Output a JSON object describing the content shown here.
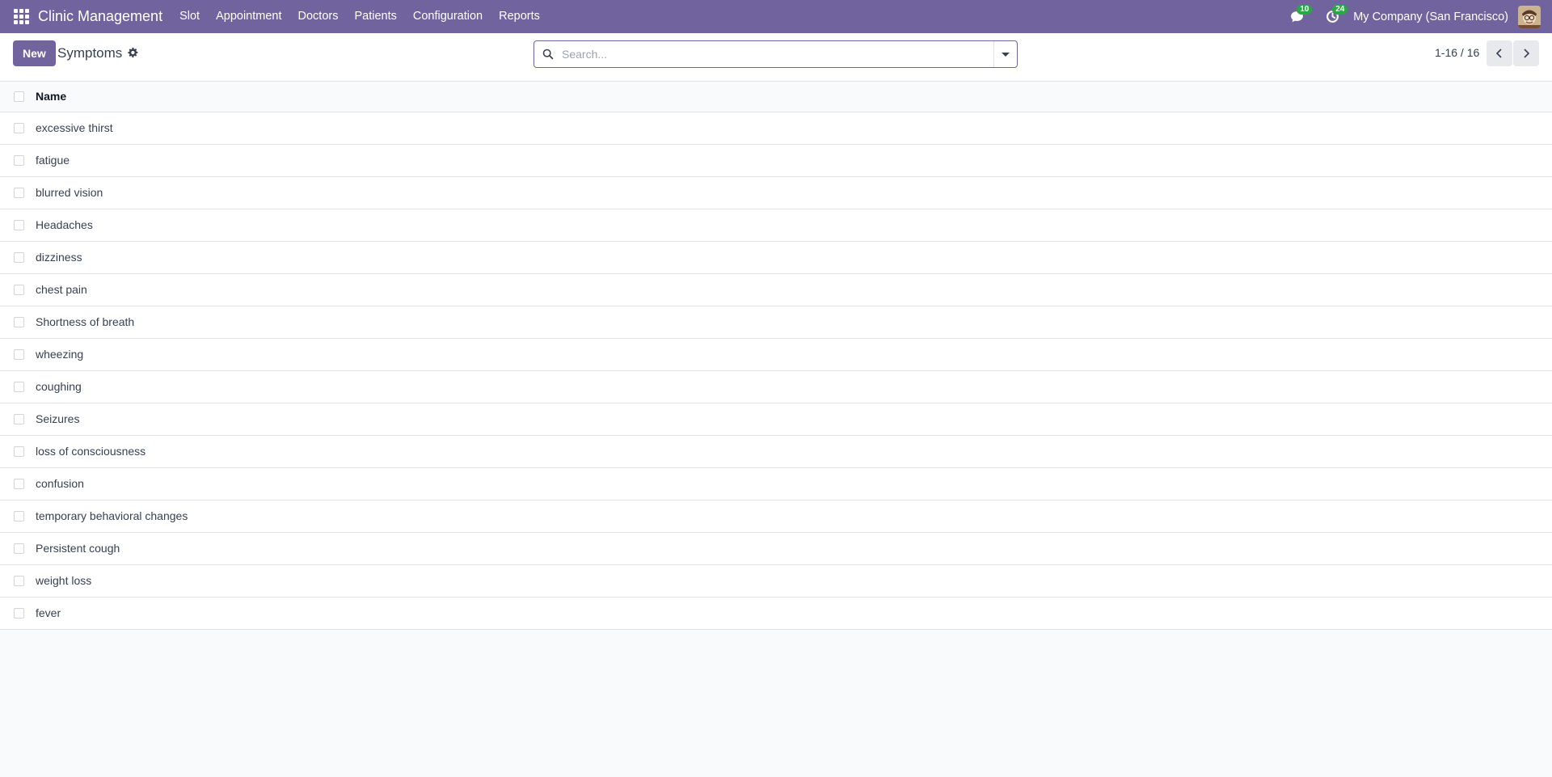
{
  "navbar": {
    "brand": "Clinic Management",
    "menu": [
      "Slot",
      "Appointment",
      "Doctors",
      "Patients",
      "Configuration",
      "Reports"
    ],
    "messages_badge": "10",
    "activities_badge": "24",
    "company": "My Company (San Francisco)"
  },
  "control": {
    "new_label": "New",
    "breadcrumb": "Symptoms",
    "search_placeholder": "Search...",
    "pager": "1-16 / 16"
  },
  "list": {
    "header": "Name",
    "rows": [
      "excessive thirst",
      "fatigue",
      "blurred vision",
      "Headaches",
      "dizziness",
      "chest pain",
      "Shortness of breath",
      "wheezing",
      "coughing",
      "Seizures",
      "loss of consciousness",
      "confusion",
      "temporary behavioral changes",
      "Persistent cough",
      "weight loss",
      "fever"
    ]
  },
  "colors": {
    "brand": "#71639e",
    "badge": "#28a745"
  },
  "icons": [
    "apps-grid-icon",
    "chat-icon",
    "activity-clock-icon",
    "gear-icon",
    "search-icon",
    "caret-down-icon",
    "chevron-left-icon",
    "chevron-right-icon"
  ]
}
